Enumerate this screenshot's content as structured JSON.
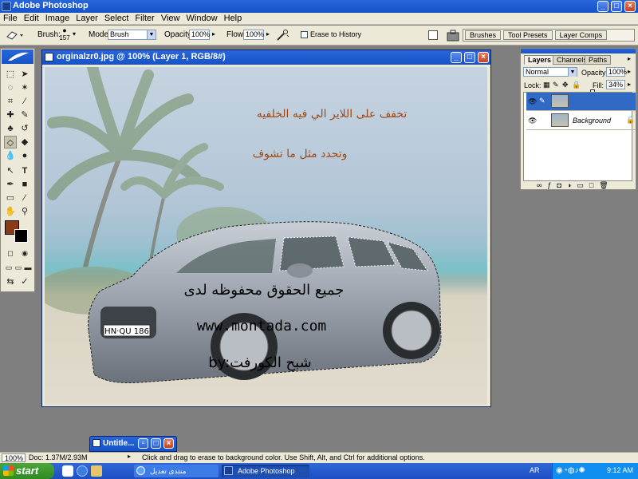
{
  "app": {
    "title": "Adobe Photoshop"
  },
  "menu": [
    "File",
    "Edit",
    "Image",
    "Layer",
    "Select",
    "Filter",
    "View",
    "Window",
    "Help"
  ],
  "options": {
    "brush_label": "Brush:",
    "brush_size": "157",
    "mode_label": "Mode:",
    "mode_value": "Brush",
    "opacity_label": "Opacity:",
    "opacity_value": "100%",
    "flow_label": "Flow:",
    "flow_value": "100%",
    "erase_history": "Erase to History",
    "palette_tabs": [
      "Brushes",
      "Tool Presets",
      "Layer Comps"
    ]
  },
  "colors": {
    "foreground": "#8b3a12",
    "background": "#000000",
    "titlebar": "#1f5fd6"
  },
  "document": {
    "title": "orginalzr0.jpg @ 100% (Layer 1, RGB/8#)",
    "arabic_line1": "تخفف على اللاير الي فيه الخلفيه",
    "arabic_line2": "وتحدد مثل ما تشوف",
    "credit_line1": "جميع الحقوق محفوظه لدى",
    "credit_url": "www.montada.com",
    "credit_by": "by:شبح الكورفت",
    "plate": "HN·QU 186"
  },
  "layers_panel": {
    "tabs": [
      "Layers",
      "Channels",
      "Paths"
    ],
    "blend_mode": "Normal",
    "opacity_label": "Opacity:",
    "opacity_value": "100%",
    "lock_label": "Lock:",
    "fill_label": "Fill:",
    "fill_value": "34%",
    "fill_level": 0.34,
    "layers": [
      {
        "name": "",
        "selected": true
      },
      {
        "name": "Background",
        "selected": false
      }
    ]
  },
  "minimized": {
    "title": "Untitle..."
  },
  "status": {
    "zoom": "100%",
    "doc": "Doc: 1.37M/2.93M",
    "hint": "Click and drag to erase to background color.  Use Shift, Alt, and Ctrl for additional options."
  },
  "taskbar": {
    "start": "start",
    "tasks": [
      "منتدى تعديل السيارات...",
      "Adobe Photoshop"
    ],
    "lang": "AR",
    "time": "9:12 AM"
  }
}
